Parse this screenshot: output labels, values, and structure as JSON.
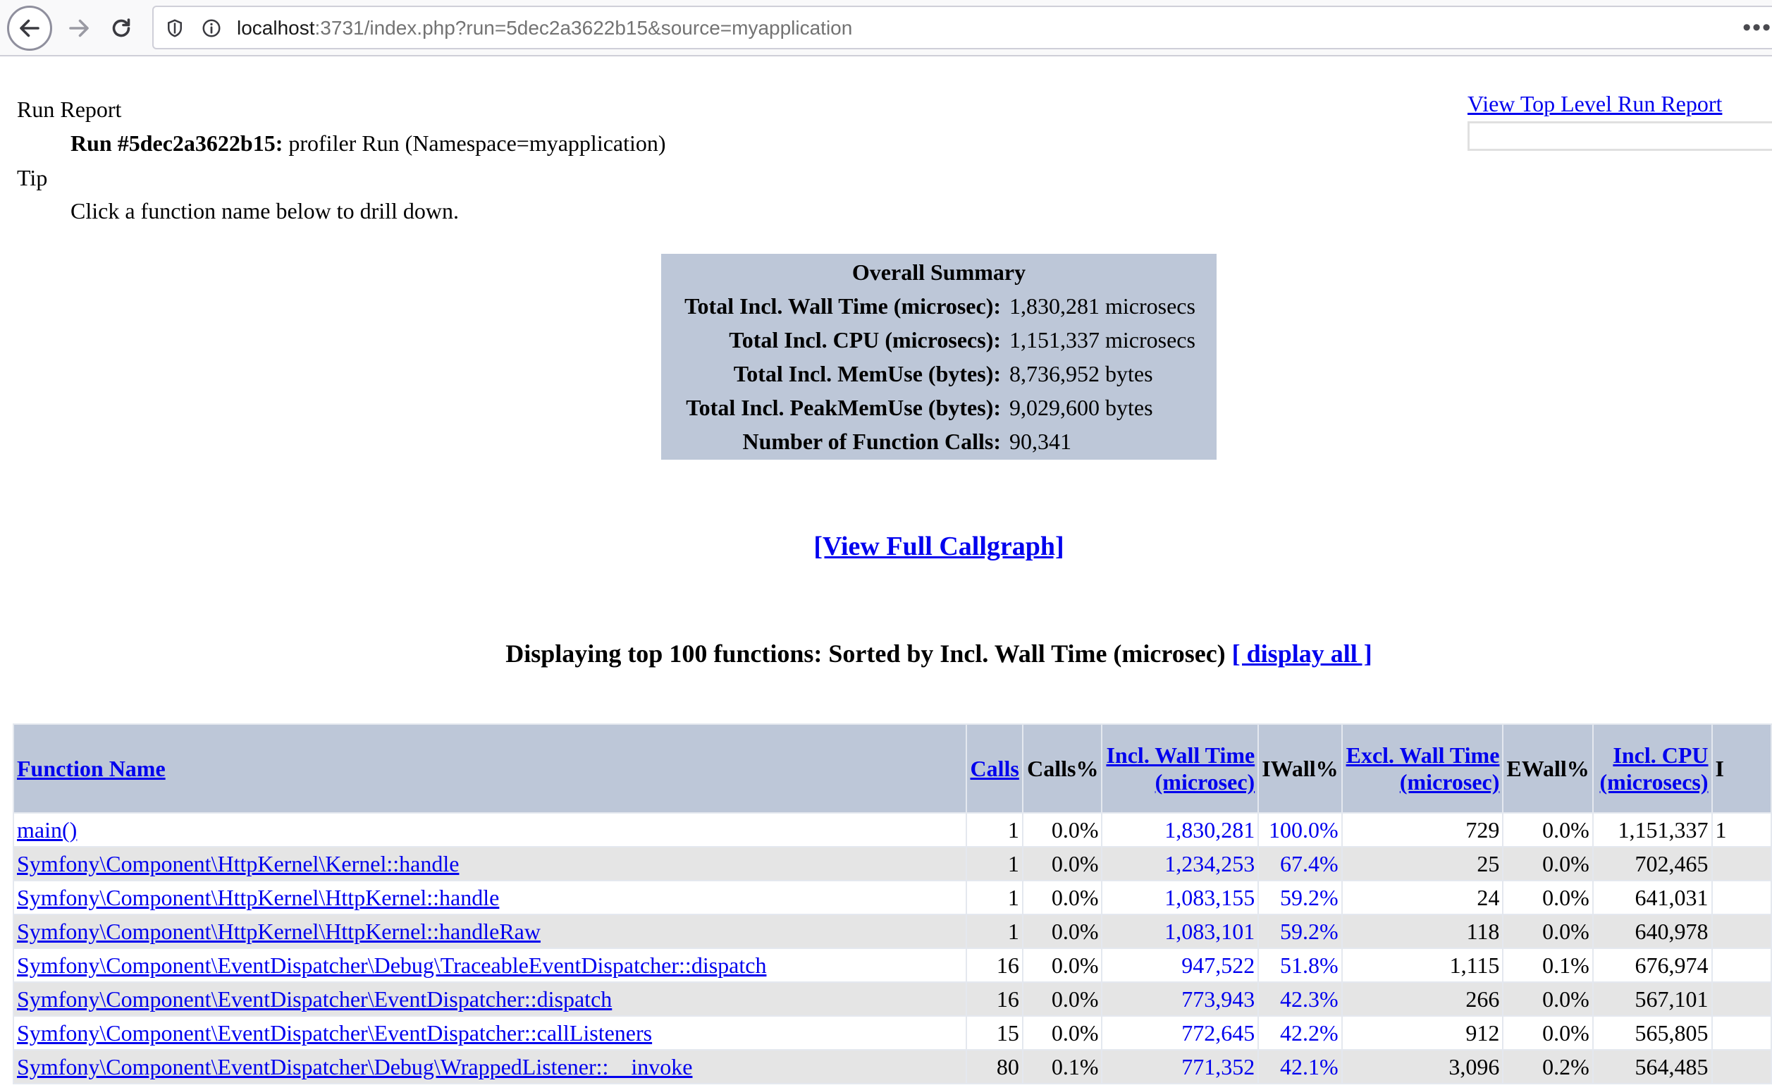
{
  "browser": {
    "url_host": "localhost",
    "url_rest": ":3731/index.php?run=5dec2a3622b15&source=myapplication",
    "menu": "•••"
  },
  "header": {
    "run_report_label": "Run Report",
    "run_id": "Run #5dec2a3622b15:",
    "run_desc": "profiler Run (Namespace=myapplication)",
    "tip_label": "Tip",
    "tip_text": "Click a function name below to drill down.",
    "top_level_link": "View Top Level Run Report"
  },
  "summary": {
    "title": "Overall Summary",
    "rows": [
      {
        "label": "Total Incl. Wall Time (microsec):",
        "value": "1,830,281 microsecs"
      },
      {
        "label": "Total Incl. CPU (microsecs):",
        "value": "1,151,337 microsecs"
      },
      {
        "label": "Total Incl. MemUse (bytes):",
        "value": "8,736,952 bytes"
      },
      {
        "label": "Total Incl. PeakMemUse (bytes):",
        "value": "9,029,600 bytes"
      },
      {
        "label": "Number of Function Calls:",
        "value": "90,341"
      }
    ]
  },
  "callgraph_link": "[View Full Callgraph]",
  "displaying": {
    "text": "Displaying top 100 functions: Sorted by Incl. Wall Time (microsec) ",
    "display_all": "[ display all ]"
  },
  "table": {
    "headers": {
      "function_name": "Function Name",
      "calls": "Calls",
      "calls_pct": "Calls%",
      "incl_wall_1": "Incl. Wall Time",
      "incl_wall_2": "(microsec)",
      "iwall_pct": "IWall%",
      "excl_wall_1": "Excl. Wall Time",
      "excl_wall_2": "(microsec)",
      "ewall_pct": "EWall%",
      "incl_cpu_1": "Incl. CPU",
      "incl_cpu_2": "(microsecs)",
      "next_col": "I"
    },
    "rows": [
      {
        "name": "main()",
        "calls": "1",
        "calls_pct": "0.0%",
        "incl_wall": "1,830,281",
        "iwall_pct": "100.0%",
        "excl_wall": "729",
        "ewall_pct": "0.0%",
        "incl_cpu": "1,151,337",
        "next": "1"
      },
      {
        "name": "Symfony\\Component\\HttpKernel\\Kernel::handle",
        "calls": "1",
        "calls_pct": "0.0%",
        "incl_wall": "1,234,253",
        "iwall_pct": "67.4%",
        "excl_wall": "25",
        "ewall_pct": "0.0%",
        "incl_cpu": "702,465",
        "next": ""
      },
      {
        "name": "Symfony\\Component\\HttpKernel\\HttpKernel::handle",
        "calls": "1",
        "calls_pct": "0.0%",
        "incl_wall": "1,083,155",
        "iwall_pct": "59.2%",
        "excl_wall": "24",
        "ewall_pct": "0.0%",
        "incl_cpu": "641,031",
        "next": ""
      },
      {
        "name": "Symfony\\Component\\HttpKernel\\HttpKernel::handleRaw",
        "calls": "1",
        "calls_pct": "0.0%",
        "incl_wall": "1,083,101",
        "iwall_pct": "59.2%",
        "excl_wall": "118",
        "ewall_pct": "0.0%",
        "incl_cpu": "640,978",
        "next": ""
      },
      {
        "name": "Symfony\\Component\\EventDispatcher\\Debug\\TraceableEventDispatcher::dispatch",
        "calls": "16",
        "calls_pct": "0.0%",
        "incl_wall": "947,522",
        "iwall_pct": "51.8%",
        "excl_wall": "1,115",
        "ewall_pct": "0.1%",
        "incl_cpu": "676,974",
        "next": ""
      },
      {
        "name": "Symfony\\Component\\EventDispatcher\\EventDispatcher::dispatch",
        "calls": "16",
        "calls_pct": "0.0%",
        "incl_wall": "773,943",
        "iwall_pct": "42.3%",
        "excl_wall": "266",
        "ewall_pct": "0.0%",
        "incl_cpu": "567,101",
        "next": ""
      },
      {
        "name": "Symfony\\Component\\EventDispatcher\\EventDispatcher::callListeners",
        "calls": "15",
        "calls_pct": "0.0%",
        "incl_wall": "772,645",
        "iwall_pct": "42.2%",
        "excl_wall": "912",
        "ewall_pct": "0.0%",
        "incl_cpu": "565,805",
        "next": ""
      },
      {
        "name": "Symfony\\Component\\EventDispatcher\\Debug\\WrappedListener::__invoke",
        "calls": "80",
        "calls_pct": "0.1%",
        "incl_wall": "771,352",
        "iwall_pct": "42.1%",
        "excl_wall": "3,096",
        "ewall_pct": "0.2%",
        "incl_cpu": "564,485",
        "next": ""
      }
    ]
  }
}
